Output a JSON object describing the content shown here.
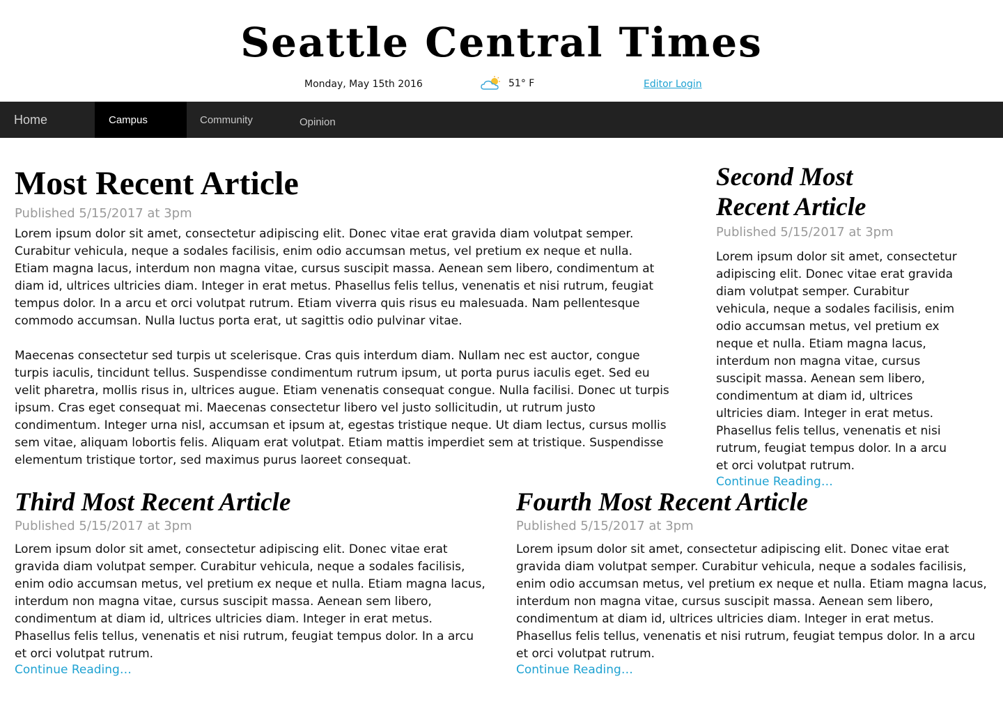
{
  "masthead": {
    "title": "Seattle Central Times",
    "date": "Monday, May 15th 2016",
    "weather_icon": "partly-cloudy-icon",
    "temperature": "51° F",
    "login_label": "Editor Login"
  },
  "nav": {
    "items": [
      {
        "label": "Home"
      },
      {
        "label": "Campus",
        "active": true
      },
      {
        "label": "Community"
      },
      {
        "label": "Opinion"
      }
    ]
  },
  "articles": [
    {
      "title": "Most Recent Article",
      "published": "Published 5/15/2017 at 3pm",
      "paragraphs": [
        "Lorem ipsum dolor sit amet, consectetur adipiscing elit. Donec vitae erat gravida diam volutpat semper. Curabitur vehicula, neque a sodales facilisis, enim odio accumsan metus, vel pretium ex neque et nulla. Etiam magna lacus, interdum non magna vitae, cursus suscipit massa. Aenean sem libero, condimentum at diam id, ultrices ultricies diam. Integer in erat metus. Phasellus felis tellus, venenatis et nisi rutrum, feugiat tempus dolor. In a arcu et orci volutpat rutrum. Etiam viverra quis risus eu malesuada. Nam pellentesque commodo accumsan. Nulla luctus porta erat, ut sagittis odio pulvinar vitae.",
        "Maecenas consectetur sed turpis ut scelerisque. Cras quis interdum diam. Nullam nec est auctor, congue turpis iaculis, tincidunt tellus. Suspendisse condimentum rutrum ipsum, ut porta purus iaculis eget. Sed eu velit pharetra, mollis risus in, ultrices augue. Etiam venenatis consequat congue. Nulla facilisi. Donec ut turpis ipsum. Cras eget consequat mi. Maecenas consectetur libero vel justo sollicitudin, ut rutrum justo condimentum. Integer urna nisl, accumsan et ipsum at, egestas tristique neque. Ut diam lectus, cursus mollis sem vitae, aliquam lobortis felis. Aliquam erat volutpat. Etiam mattis imperdiet sem at tristique. Suspendisse elementum tristique tortor, sed maximus purus laoreet consequat."
      ]
    },
    {
      "title": "Second Most Recent Article",
      "published": "Published 5/15/2017 at 3pm",
      "body": "Lorem ipsum dolor sit amet, consectetur adipiscing elit. Donec vitae erat gravida diam volutpat semper. Curabitur vehicula, neque a sodales facilisis, enim odio accumsan metus, vel pretium ex neque et nulla. Etiam magna lacus, interdum non magna vitae, cursus suscipit massa. Aenean sem libero, condimentum at diam id, ultrices ultricies diam. Integer in erat metus. Phasellus felis tellus, venenatis et nisi rutrum, feugiat tempus dolor. In a arcu et orci volutpat rutrum.",
      "more": "Continue Reading…"
    },
    {
      "title": "Third Most Recent Article",
      "published": "Published 5/15/2017 at 3pm",
      "body": "Lorem ipsum dolor sit amet, consectetur adipiscing elit. Donec vitae erat gravida diam volutpat semper. Curabitur vehicula, neque a sodales facilisis, enim odio accumsan metus, vel pretium ex neque et nulla. Etiam magna lacus, interdum non magna vitae, cursus suscipit massa. Aenean sem libero, condimentum at diam id, ultrices ultricies diam. Integer in erat metus. Phasellus felis tellus, venenatis et nisi rutrum, feugiat tempus dolor. In a arcu et orci volutpat rutrum.",
      "more": "Continue Reading…"
    },
    {
      "title": "Fourth Most Recent Article",
      "published": "Published 5/15/2017 at 3pm",
      "body": "Lorem ipsum dolor sit amet, consectetur adipiscing elit. Donec vitae erat gravida diam volutpat semper. Curabitur vehicula, neque a sodales facilisis, enim odio accumsan metus, vel pretium ex neque et nulla. Etiam magna lacus, interdum non magna vitae, cursus suscipit massa. Aenean sem libero, condimentum at diam id, ultrices ultricies diam. Integer in erat metus. Phasellus felis tellus, venenatis et nisi rutrum, feugiat tempus dolor. In a arcu et orci volutpat rutrum.",
      "more": "Continue Reading…"
    }
  ],
  "colors": {
    "nav_bg": "#222222",
    "nav_active_bg": "#000000",
    "link": "#1fa2d2",
    "meta": "#9a9a9a"
  }
}
